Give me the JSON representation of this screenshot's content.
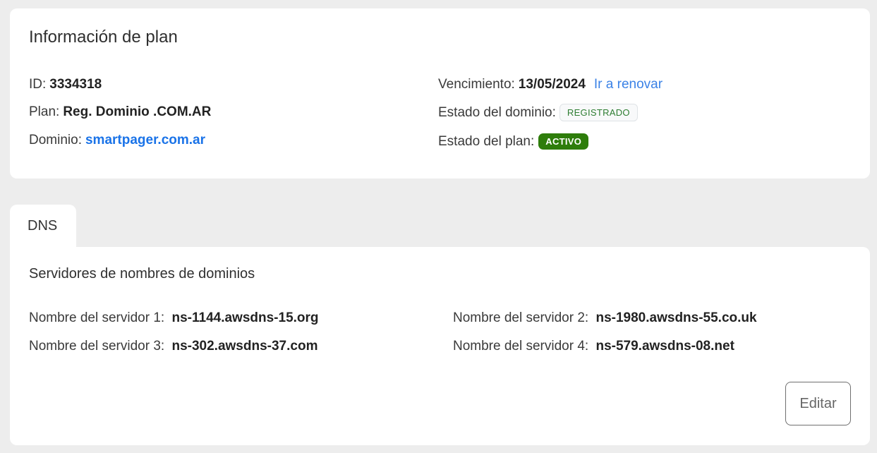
{
  "plan": {
    "title": "Información de plan",
    "id_label": "ID:",
    "id_value": "3334318",
    "plan_label": "Plan:",
    "plan_value": "Reg. Dominio .COM.AR",
    "domain_label": "Dominio:",
    "domain_value": "smartpager.com.ar",
    "expiry_label": "Vencimiento:",
    "expiry_value": "13/05/2024",
    "renew_link": "Ir a renovar",
    "domain_status_label": "Estado del dominio:",
    "domain_status_value": "REGISTRADO",
    "plan_status_label": "Estado del plan:",
    "plan_status_value": "ACTIVO"
  },
  "tabs": {
    "dns_label": "DNS"
  },
  "dns": {
    "title": "Servidores de nombres de dominios",
    "servers": [
      {
        "label": "Nombre del servidor 1:",
        "value": "ns-1144.awsdns-15.org"
      },
      {
        "label": "Nombre del servidor 2:",
        "value": "ns-1980.awsdns-55.co.uk"
      },
      {
        "label": "Nombre del servidor 3:",
        "value": "ns-302.awsdns-37.com"
      },
      {
        "label": "Nombre del servidor 4:",
        "value": "ns-579.awsdns-08.net"
      }
    ],
    "edit_label": "Editar"
  },
  "colors": {
    "background": "#ededed",
    "card": "#ffffff",
    "link": "#1a73e8",
    "badge_registered_text": "#2e7d32",
    "badge_active_bg": "#2e7d0b"
  }
}
